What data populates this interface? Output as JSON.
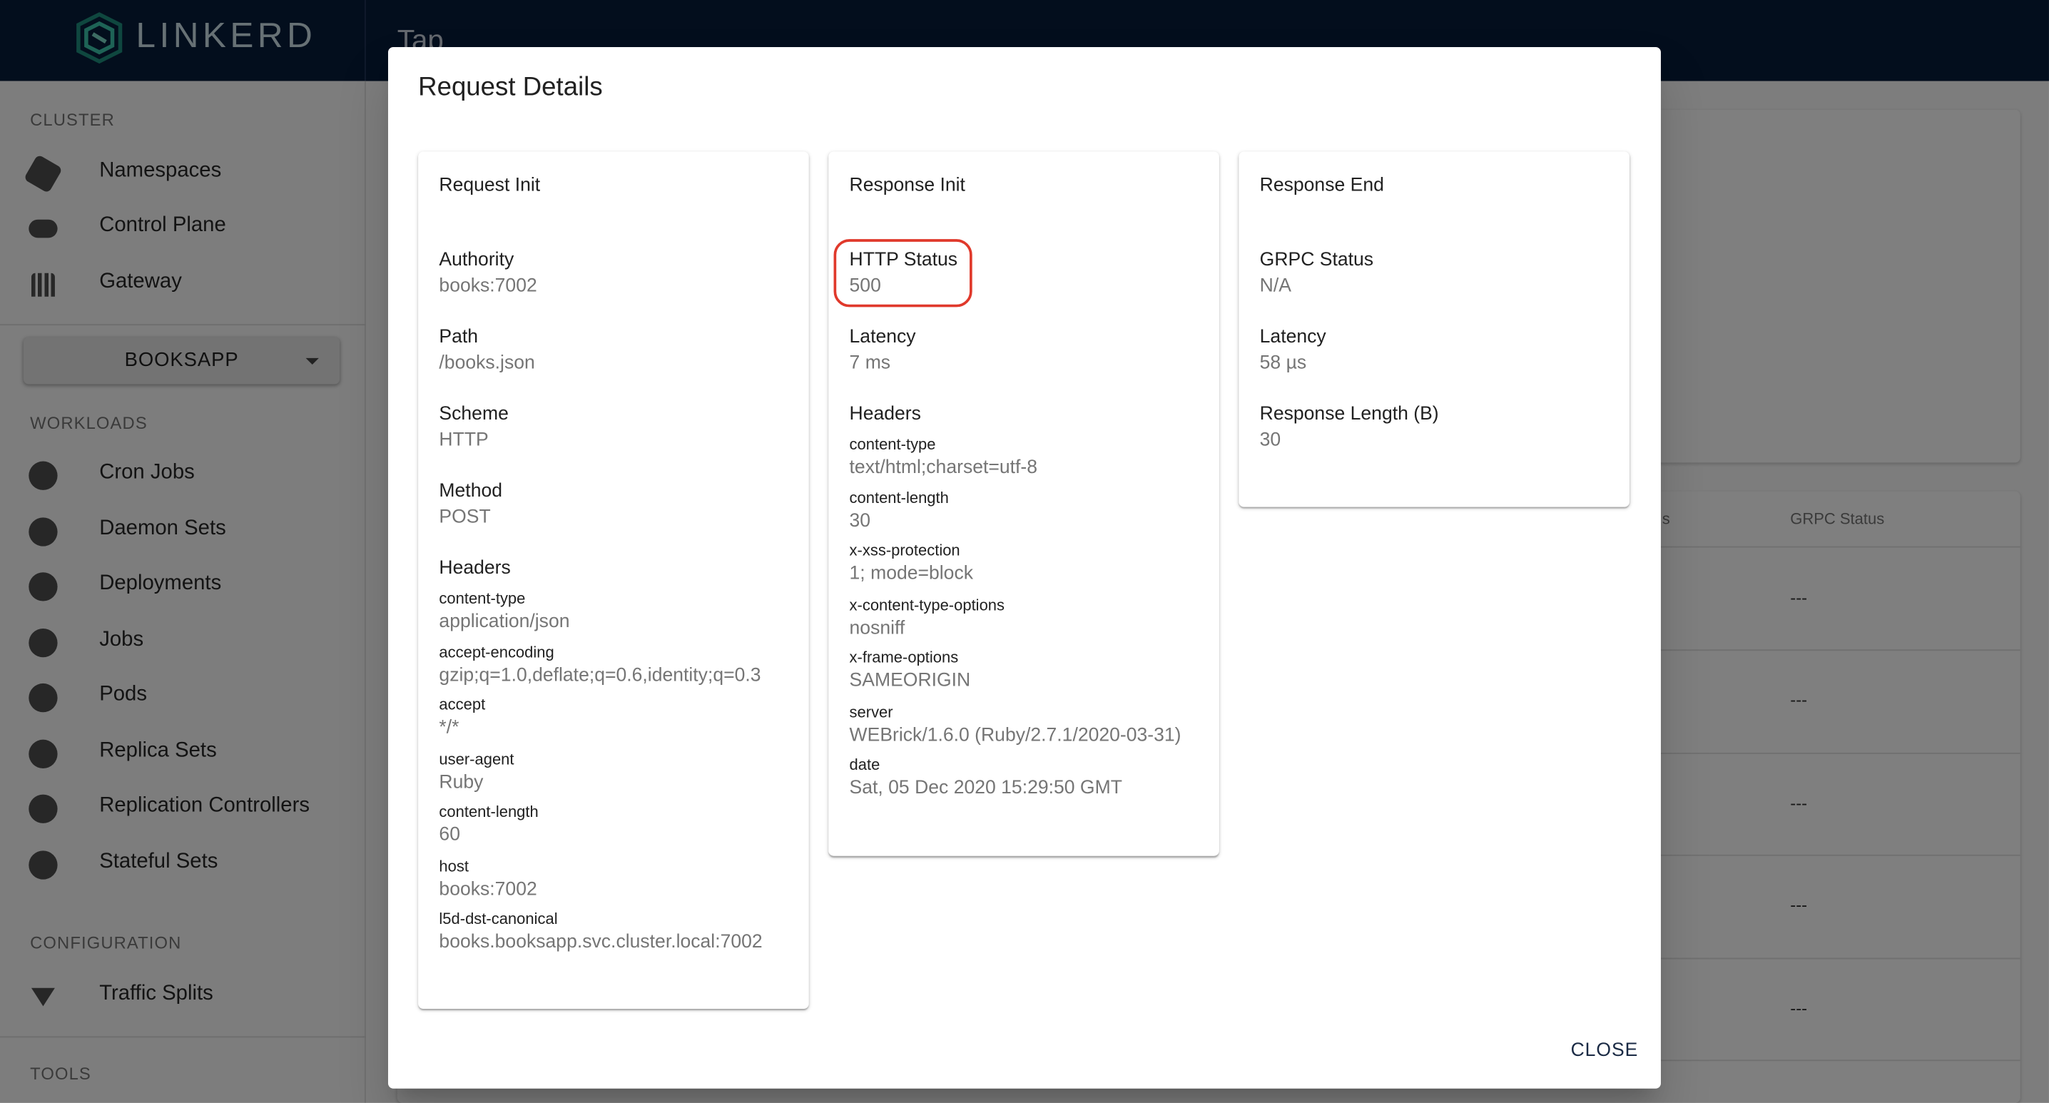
{
  "app": {
    "brand": "LINKERD",
    "page_title": "Tap"
  },
  "sidebar": {
    "cluster_heading": "CLUSTER",
    "cluster_items": [
      {
        "label": "Namespaces",
        "icon": "namespace-icon"
      },
      {
        "label": "Control Plane",
        "icon": "cloud-icon"
      },
      {
        "label": "Gateway",
        "icon": "gateway-icon"
      }
    ],
    "namespace_select": "BOOKSAPP",
    "workloads_heading": "WORKLOADS",
    "workload_items": [
      {
        "label": "Cron Jobs",
        "icon": "cronjob-icon"
      },
      {
        "label": "Daemon Sets",
        "icon": "daemonset-icon"
      },
      {
        "label": "Deployments",
        "icon": "deployment-icon"
      },
      {
        "label": "Jobs",
        "icon": "job-icon"
      },
      {
        "label": "Pods",
        "icon": "pod-icon"
      },
      {
        "label": "Replica Sets",
        "icon": "replicaset-icon"
      },
      {
        "label": "Replication Controllers",
        "icon": "replicationcontroller-icon"
      },
      {
        "label": "Stateful Sets",
        "icon": "statefulset-icon"
      }
    ],
    "configuration_heading": "CONFIGURATION",
    "configuration_items": [
      {
        "label": "Traffic Splits",
        "icon": "filter-icon"
      }
    ],
    "tools_heading": "TOOLS"
  },
  "background_table": {
    "partial_header": "s",
    "grpc_header": "GRPC Status",
    "row_values": [
      "---",
      "---",
      "---",
      "---",
      "---"
    ]
  },
  "dialog": {
    "title": "Request Details",
    "close_label": "CLOSE",
    "request_init": {
      "title": "Request Init",
      "authority_label": "Authority",
      "authority": "books:7002",
      "path_label": "Path",
      "path": "/books.json",
      "scheme_label": "Scheme",
      "scheme": "HTTP",
      "method_label": "Method",
      "method": "POST",
      "headers_label": "Headers",
      "headers": [
        {
          "name": "content-type",
          "value": "application/json"
        },
        {
          "name": "accept-encoding",
          "value": "gzip;q=1.0,deflate;q=0.6,identity;q=0.3"
        },
        {
          "name": "accept",
          "value": "*/*"
        },
        {
          "name": "user-agent",
          "value": "Ruby"
        },
        {
          "name": "content-length",
          "value": "60"
        },
        {
          "name": "host",
          "value": "books:7002"
        },
        {
          "name": "l5d-dst-canonical",
          "value": "books.booksapp.svc.cluster.local:7002"
        }
      ]
    },
    "response_init": {
      "title": "Response Init",
      "http_status_label": "HTTP Status",
      "http_status": "500",
      "latency_label": "Latency",
      "latency": "7 ms",
      "headers_label": "Headers",
      "headers": [
        {
          "name": "content-type",
          "value": "text/html;charset=utf-8"
        },
        {
          "name": "content-length",
          "value": "30"
        },
        {
          "name": "x-xss-protection",
          "value": "1; mode=block"
        },
        {
          "name": "x-content-type-options",
          "value": "nosniff"
        },
        {
          "name": "x-frame-options",
          "value": "SAMEORIGIN"
        },
        {
          "name": "server",
          "value": "WEBrick/1.6.0 (Ruby/2.7.1/2020-03-31)"
        },
        {
          "name": "date",
          "value": "Sat, 05 Dec 2020 15:29:50 GMT"
        }
      ]
    },
    "response_end": {
      "title": "Response End",
      "grpc_status_label": "GRPC Status",
      "grpc_status": "N/A",
      "latency_label": "Latency",
      "latency": "58 µs",
      "response_length_label": "Response Length (B)",
      "response_length": "30"
    }
  },
  "colors": {
    "topbar": "#071d3b",
    "highlight": "#e0392b",
    "brand_text": "#cfe3ea"
  }
}
